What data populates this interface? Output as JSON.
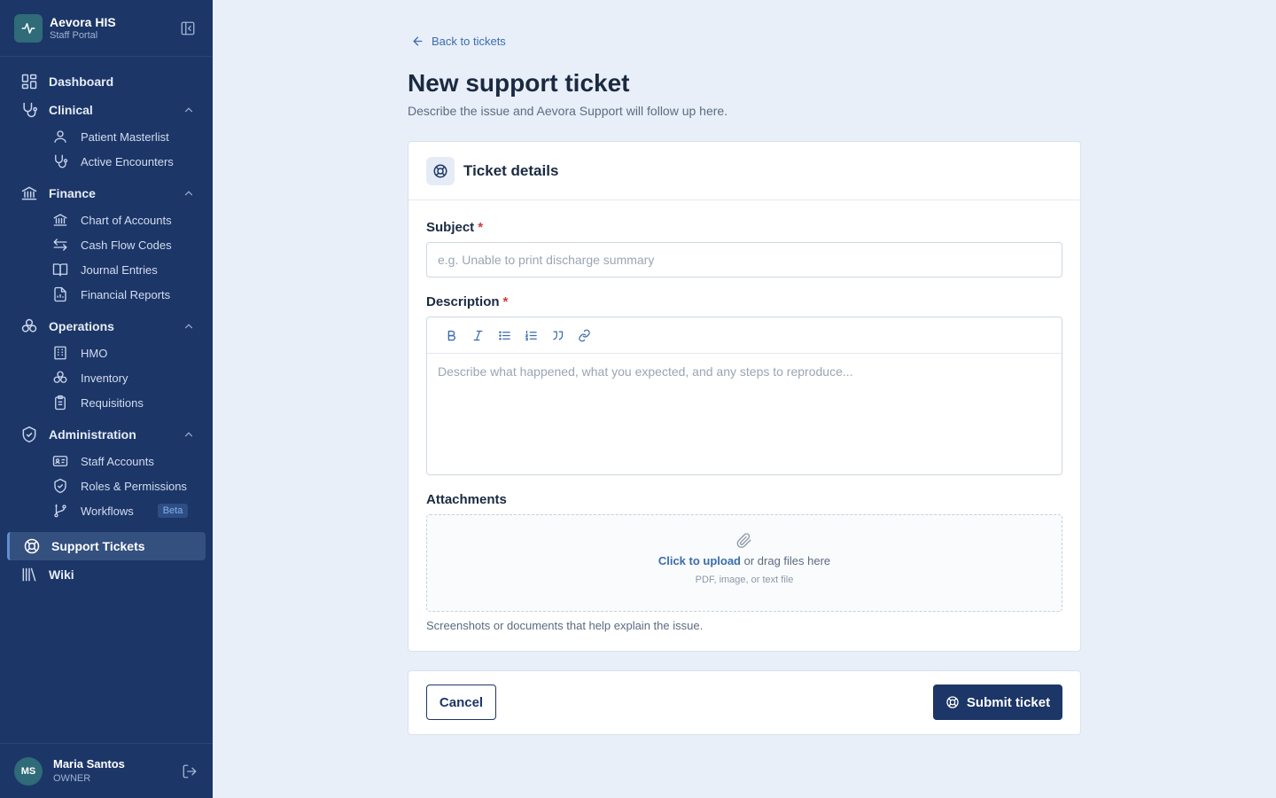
{
  "app": {
    "title": "Aevora HIS",
    "subtitle": "Staff Portal"
  },
  "sidebar": {
    "dashboard": "Dashboard",
    "clinical": {
      "label": "Clinical",
      "items": [
        "Patient Masterlist",
        "Active Encounters"
      ]
    },
    "finance": {
      "label": "Finance",
      "items": [
        "Chart of Accounts",
        "Cash Flow Codes",
        "Journal Entries",
        "Financial Reports"
      ]
    },
    "operations": {
      "label": "Operations",
      "items": [
        "HMO",
        "Inventory",
        "Requisitions"
      ]
    },
    "administration": {
      "label": "Administration",
      "items": [
        "Staff Accounts",
        "Roles & Permissions",
        "Workflows"
      ],
      "workflows_badge": "Beta"
    },
    "support_tickets": "Support Tickets",
    "wiki": "Wiki"
  },
  "user": {
    "initials": "MS",
    "name": "Maria Santos",
    "role": "OWNER"
  },
  "page": {
    "back_link": "Back to tickets",
    "title": "New support ticket",
    "subtitle": "Describe the issue and Aevora Support will follow up here."
  },
  "form": {
    "card_title": "Ticket details",
    "subject_label": "Subject",
    "subject_required": "*",
    "subject_placeholder": "e.g. Unable to print discharge summary",
    "subject_value": "",
    "description_label": "Description",
    "description_required": "*",
    "description_placeholder": "Describe what happened, what you expected, and any steps to reproduce...",
    "attachments_label": "Attachments",
    "upload_link": "Click to upload",
    "upload_rest": " or drag files here",
    "upload_hint": "PDF, image, or text file",
    "attachments_help": "Screenshots or documents that help explain the issue."
  },
  "actions": {
    "cancel": "Cancel",
    "submit": "Submit ticket"
  },
  "colors": {
    "sidebar_bg": "#1c3667",
    "page_bg": "#e8eff9",
    "accent": "#3a6cb0",
    "required": "#d13b3b"
  }
}
